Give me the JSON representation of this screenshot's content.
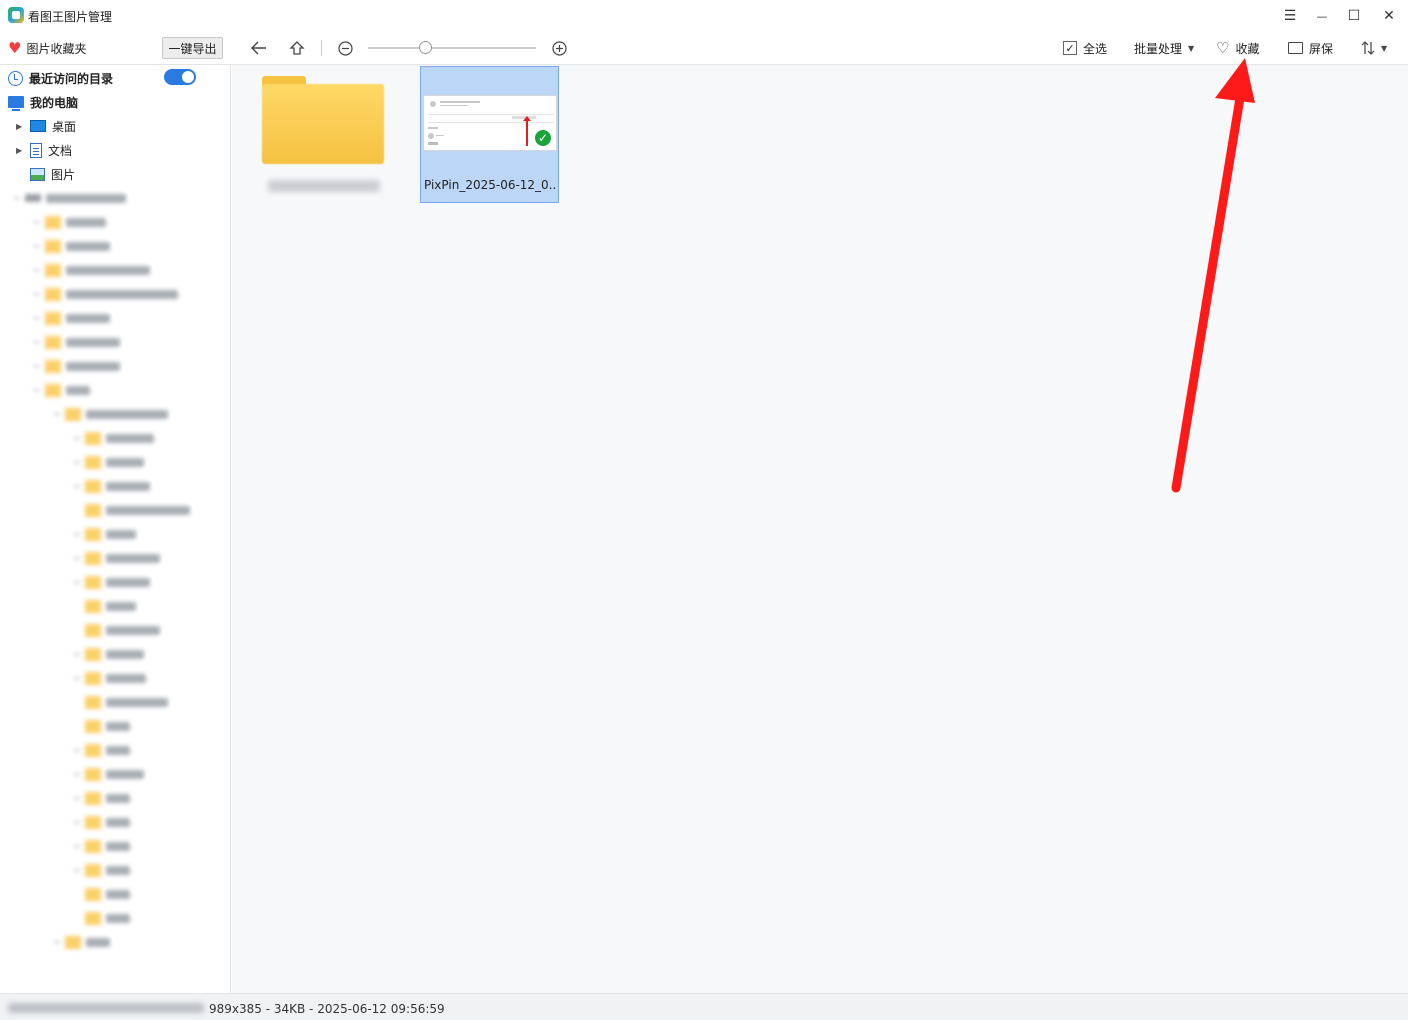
{
  "app": {
    "title": "看图王图片管理"
  },
  "window_controls": {
    "menu": "☰",
    "minimize": "—",
    "maximize": "☐",
    "close": "✕"
  },
  "toolbar": {
    "favorites_label": "图片收藏夹",
    "export_label": "一键导出",
    "select_all_label": "全选",
    "batch_label": "批量处理",
    "favorite_label": "收藏",
    "screensaver_label": "屏保"
  },
  "sidebar": {
    "recent_label": "最近访问的目录",
    "recent_toggle_on": true,
    "my_pc_label": "我的电脑",
    "items": [
      {
        "label": "桌面",
        "icon": "desktop-icon"
      },
      {
        "label": "文档",
        "icon": "document-icon"
      },
      {
        "label": "图片",
        "icon": "pictures-icon"
      }
    ]
  },
  "main": {
    "files": [
      {
        "name": "PixPin_2025-06-12_0...",
        "selected": true,
        "checked": true
      }
    ]
  },
  "status": {
    "info": "989x385 - 34KB - 2025-06-12 09:56:59"
  },
  "colors": {
    "accent": "#2a7ae2",
    "selection": "#bcd6f7",
    "annotation": "#ff1a1a"
  }
}
